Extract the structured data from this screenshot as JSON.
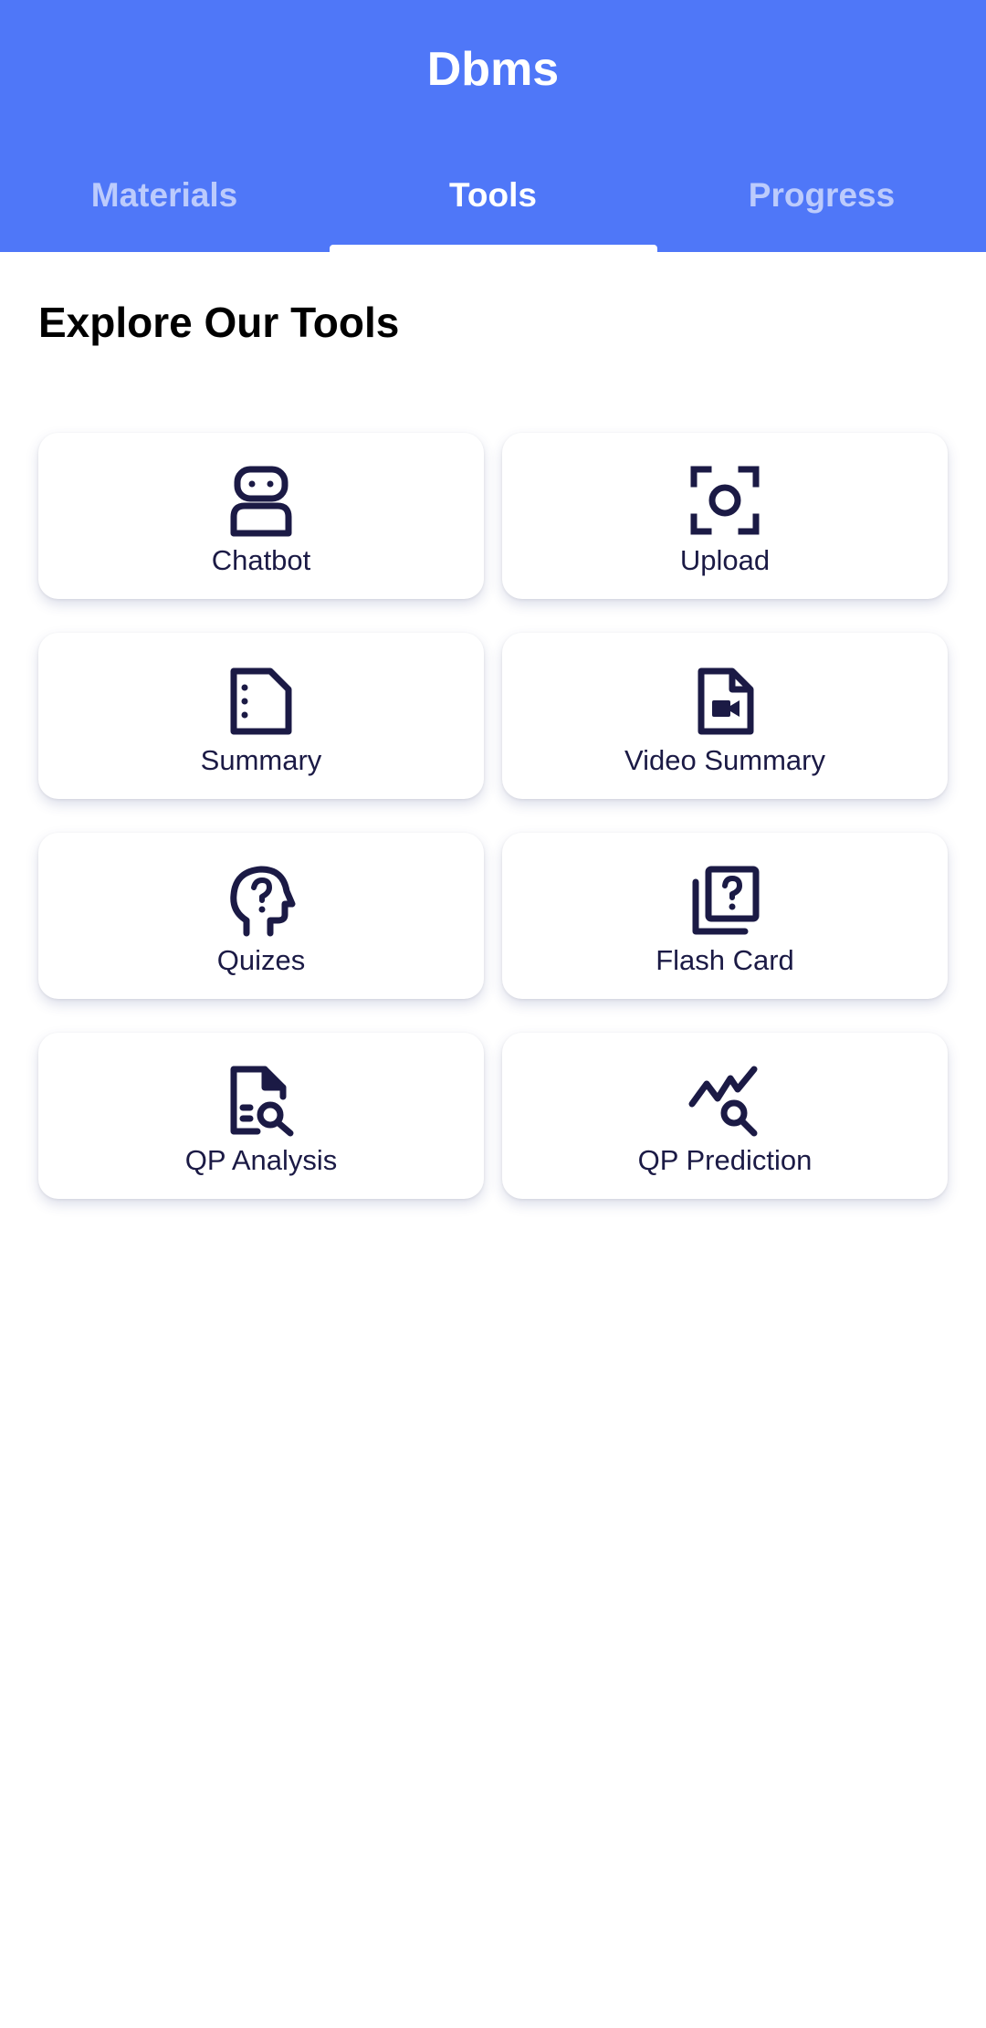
{
  "header": {
    "title": "Dbms",
    "tabs": [
      {
        "label": "Materials",
        "active": false
      },
      {
        "label": "Tools",
        "active": true
      },
      {
        "label": "Progress",
        "active": false
      }
    ]
  },
  "main": {
    "section_title": "Explore Our Tools",
    "tools": [
      {
        "label": "Chatbot",
        "icon": "robot-icon"
      },
      {
        "label": "Upload",
        "icon": "camera-scan-icon"
      },
      {
        "label": "Summary",
        "icon": "document-list-icon"
      },
      {
        "label": "Video Summary",
        "icon": "video-file-icon"
      },
      {
        "label": "Quizes",
        "icon": "head-question-icon"
      },
      {
        "label": "Flash Card",
        "icon": "question-cards-icon"
      },
      {
        "label": "QP Analysis",
        "icon": "document-search-icon"
      },
      {
        "label": "QP Prediction",
        "icon": "trend-search-icon"
      }
    ]
  },
  "colors": {
    "header_bg": "#4f77f8",
    "icon_color": "#1b1a45",
    "tab_inactive": "rgba(255,255,255,0.62)"
  }
}
